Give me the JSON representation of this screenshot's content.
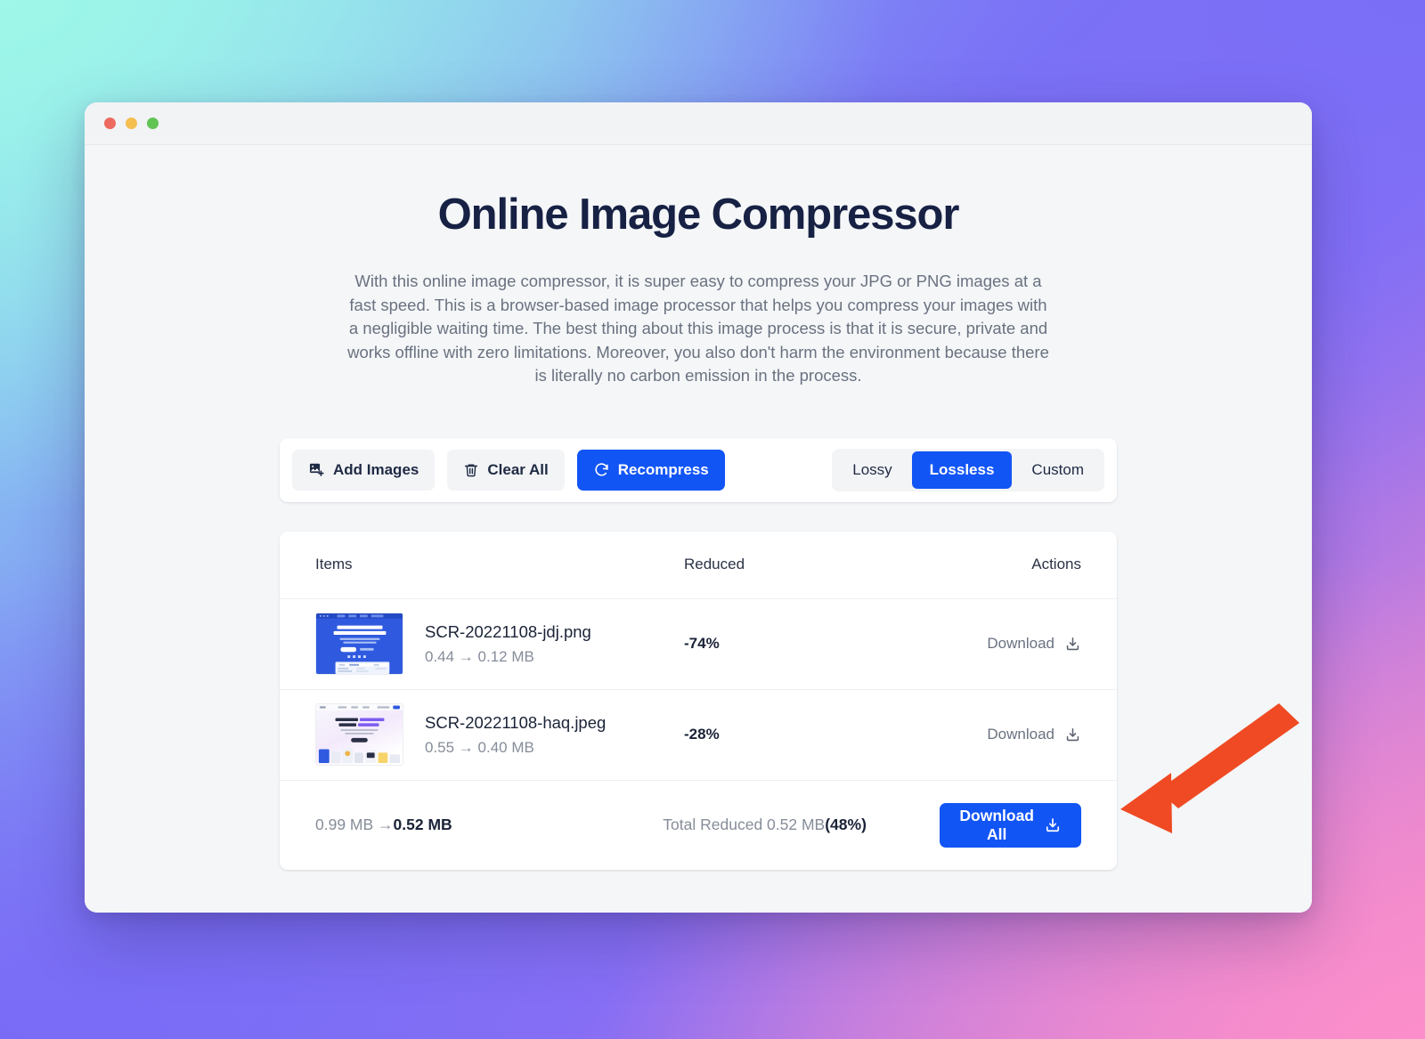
{
  "window": {
    "traffic_lights": [
      "close",
      "minimize",
      "zoom"
    ]
  },
  "hero": {
    "title": "Online Image Compressor",
    "subtitle": "With this online image compressor, it is super easy to compress your JPG or PNG images at a fast speed. This is a browser-based image processor that helps you compress your images with a negligible waiting time. The best thing about this image process is that it is secure, private and works offline with zero limitations. Moreover, you also don't harm the environment because there is literally no carbon emission in the process."
  },
  "toolbar": {
    "add_images_label": "Add Images",
    "add_images_icon": "image-plus-icon",
    "clear_all_label": "Clear All",
    "clear_all_icon": "trash-icon",
    "recompress_label": "Recompress",
    "recompress_icon": "refresh-icon",
    "modes": [
      {
        "label": "Lossy",
        "active": false
      },
      {
        "label": "Lossless",
        "active": true
      },
      {
        "label": "Custom",
        "active": false
      }
    ]
  },
  "table": {
    "columns": [
      "Items",
      "Reduced",
      "Actions"
    ],
    "rows": [
      {
        "filename": "SCR-20221108-jdj.png",
        "size": "0.44 → 0.12 MB",
        "reduced": "-74%",
        "action_label": "Download",
        "action_icon": "download-icon",
        "thumb": "blue-landing-page"
      },
      {
        "filename": "SCR-20221108-haq.jpeg",
        "size": "0.55 → 0.40 MB",
        "reduced": "-28%",
        "action_label": "Download",
        "action_icon": "download-icon",
        "thumb": "light-gallery-page"
      }
    ],
    "footer": {
      "total_size_before": "0.99 MB → ",
      "total_size_after": "0.52 MB",
      "total_reduced_prefix": "Total Reduced 0.52 MB",
      "total_reduced_pct": "(48%)",
      "download_all_label": "Download All",
      "download_all_icon": "download-icon"
    }
  },
  "annotation": {
    "arrow_color": "#ef4a23",
    "arrow_points_to": "download-all-button"
  },
  "colors": {
    "accent": "#1255f5",
    "title": "#172144",
    "muted": "#6a7280",
    "card": "#ffffff",
    "page_bg": "#f4f6f8",
    "arrow": "#ef4a23"
  }
}
